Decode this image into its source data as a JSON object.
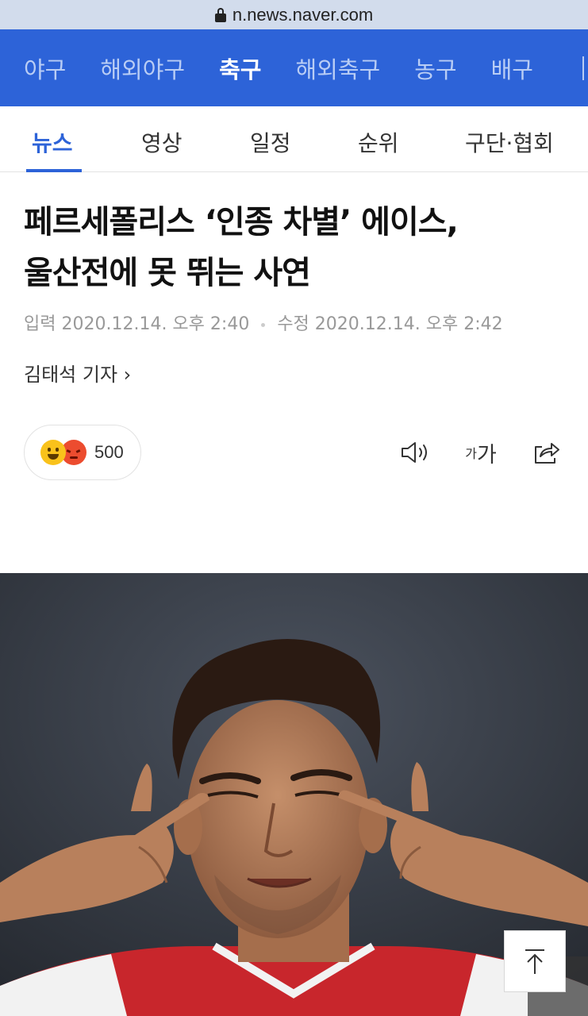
{
  "browser": {
    "url": "n.news.naver.com"
  },
  "top_nav": {
    "items": [
      {
        "label": "야구",
        "active": false
      },
      {
        "label": "해외야구",
        "active": false
      },
      {
        "label": "축구",
        "active": true
      },
      {
        "label": "해외축구",
        "active": false
      },
      {
        "label": "농구",
        "active": false
      },
      {
        "label": "배구",
        "active": false
      }
    ]
  },
  "sub_tabs": {
    "items": [
      {
        "label": "뉴스",
        "active": true
      },
      {
        "label": "영상",
        "active": false
      },
      {
        "label": "일정",
        "active": false
      },
      {
        "label": "순위",
        "active": false
      },
      {
        "label": "구단·협회",
        "active": false
      }
    ]
  },
  "article": {
    "headline_line1": "페르세폴리스 ‘인종 차별’ 에이스,",
    "headline_line2": "울산전에 못 뛰는 사연",
    "input_label": "입력",
    "input_time": "2020.12.14. 오후 2:40",
    "edit_label": "수정",
    "edit_time": "2020.12.14. 오후 2:42",
    "reporter": "김태석 기자 ›"
  },
  "reactions": {
    "count": "500",
    "icons": [
      "happy-emoji-icon",
      "angry-emoji-icon"
    ]
  },
  "tools": {
    "font_small": "가",
    "font_big": "가"
  },
  "colors": {
    "nav_blue": "#2d63d8",
    "inactive_nav_text": "#b9cdf5",
    "url_bar": "#d2dcec"
  }
}
